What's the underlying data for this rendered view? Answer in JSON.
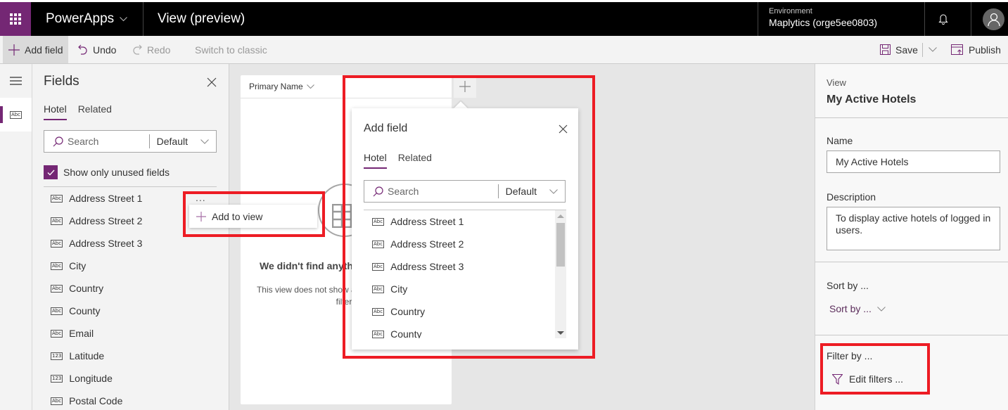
{
  "topbar": {
    "app_name": "PowerApps",
    "page_title": "View (preview)",
    "environment_label": "Environment",
    "environment_name": "Maplytics (orge5ee0803)"
  },
  "commandbar": {
    "add_field": "Add field",
    "undo": "Undo",
    "redo": "Redo",
    "switch_to_classic": "Switch to classic",
    "save": "Save",
    "publish": "Publish"
  },
  "fields_panel": {
    "title": "Fields",
    "tabs": [
      {
        "label": "Hotel",
        "active": true
      },
      {
        "label": "Related",
        "active": false
      }
    ],
    "search_placeholder": "Search",
    "filter_dropdown": "Default",
    "show_unused_label": "Show only unused fields",
    "show_unused_checked": true,
    "items": [
      {
        "label": "Address Street 1",
        "type": "Abc"
      },
      {
        "label": "Address Street 2",
        "type": "Abc"
      },
      {
        "label": "Address Street 3",
        "type": "Abc"
      },
      {
        "label": "City",
        "type": "Abc"
      },
      {
        "label": "Country",
        "type": "Abc"
      },
      {
        "label": "County",
        "type": "Abc"
      },
      {
        "label": "Email",
        "type": "Abc"
      },
      {
        "label": "Latitude",
        "type": "123"
      },
      {
        "label": "Longitude",
        "type": "123"
      },
      {
        "label": "Postal Code",
        "type": "Abc"
      }
    ],
    "more_menu": "...",
    "context_menu_item": "Add to view"
  },
  "grid": {
    "column_header": "Primary Name",
    "empty_title": "We didn't find anything to show here",
    "empty_description": "This view does not show any records or remove filters"
  },
  "add_field_callout": {
    "title": "Add field",
    "tabs": [
      {
        "label": "Hotel",
        "active": true
      },
      {
        "label": "Related",
        "active": false
      }
    ],
    "search_placeholder": "Search",
    "filter_dropdown": "Default",
    "items": [
      {
        "label": "Address Street 1",
        "type": "Abc"
      },
      {
        "label": "Address Street 2",
        "type": "Abc"
      },
      {
        "label": "Address Street 3",
        "type": "Abc"
      },
      {
        "label": "City",
        "type": "Abc"
      },
      {
        "label": "Country",
        "type": "Abc"
      },
      {
        "label": "County",
        "type": "Abc"
      }
    ]
  },
  "properties": {
    "section_label": "View",
    "view_name": "My Active Hotels",
    "name_label": "Name",
    "name_value": "My Active Hotels",
    "description_label": "Description",
    "description_value": "To display active hotels of logged in users.",
    "sort_label": "Sort by ...",
    "sort_dropdown": "Sort by ...",
    "filter_label": "Filter by ...",
    "edit_filters": "Edit filters ..."
  },
  "colors": {
    "brand": "#742774",
    "highlight": "#ed1c24",
    "topbar": "#000000"
  }
}
